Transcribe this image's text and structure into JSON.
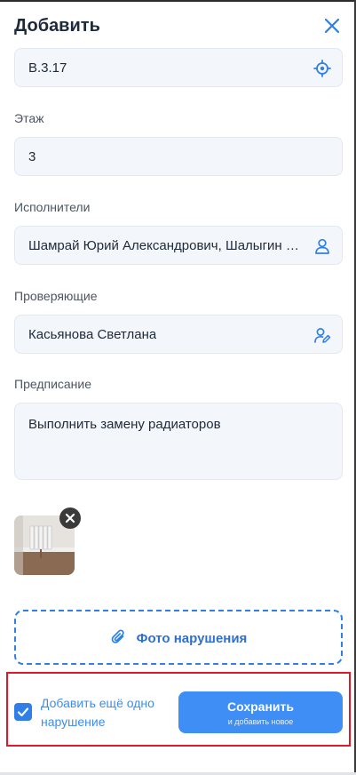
{
  "header": {
    "title": "Добавить",
    "close_icon": "close-icon"
  },
  "fields": {
    "location": {
      "value": "В.3.17",
      "icon": "target-icon"
    },
    "floor": {
      "label": "Этаж",
      "value": "3"
    },
    "executors": {
      "label": "Исполнители",
      "value": "Шамрай Юрий Александрович, Шалыгин Сергей",
      "icon": "user-icon"
    },
    "inspectors": {
      "label": "Проверяющие",
      "value": "Касьянова Светлана",
      "icon": "user-edit-icon"
    },
    "prescription": {
      "label": "Предписание",
      "value": "Выполнить замену радиаторов"
    }
  },
  "photo": {
    "remove_icon": "remove-photo-icon"
  },
  "photo_button": {
    "label": "Фото нарушения",
    "icon": "paperclip-icon"
  },
  "footer": {
    "add_another_label": "Добавить ещё одно нарушение",
    "add_another_checked": true,
    "save_label": "Сохранить",
    "save_sublabel": "и добавить новое"
  },
  "colors": {
    "accent": "#2f7fe6",
    "button": "#3f8ef5",
    "field_bg": "#f3f7fb",
    "highlight": "#e0182a"
  }
}
